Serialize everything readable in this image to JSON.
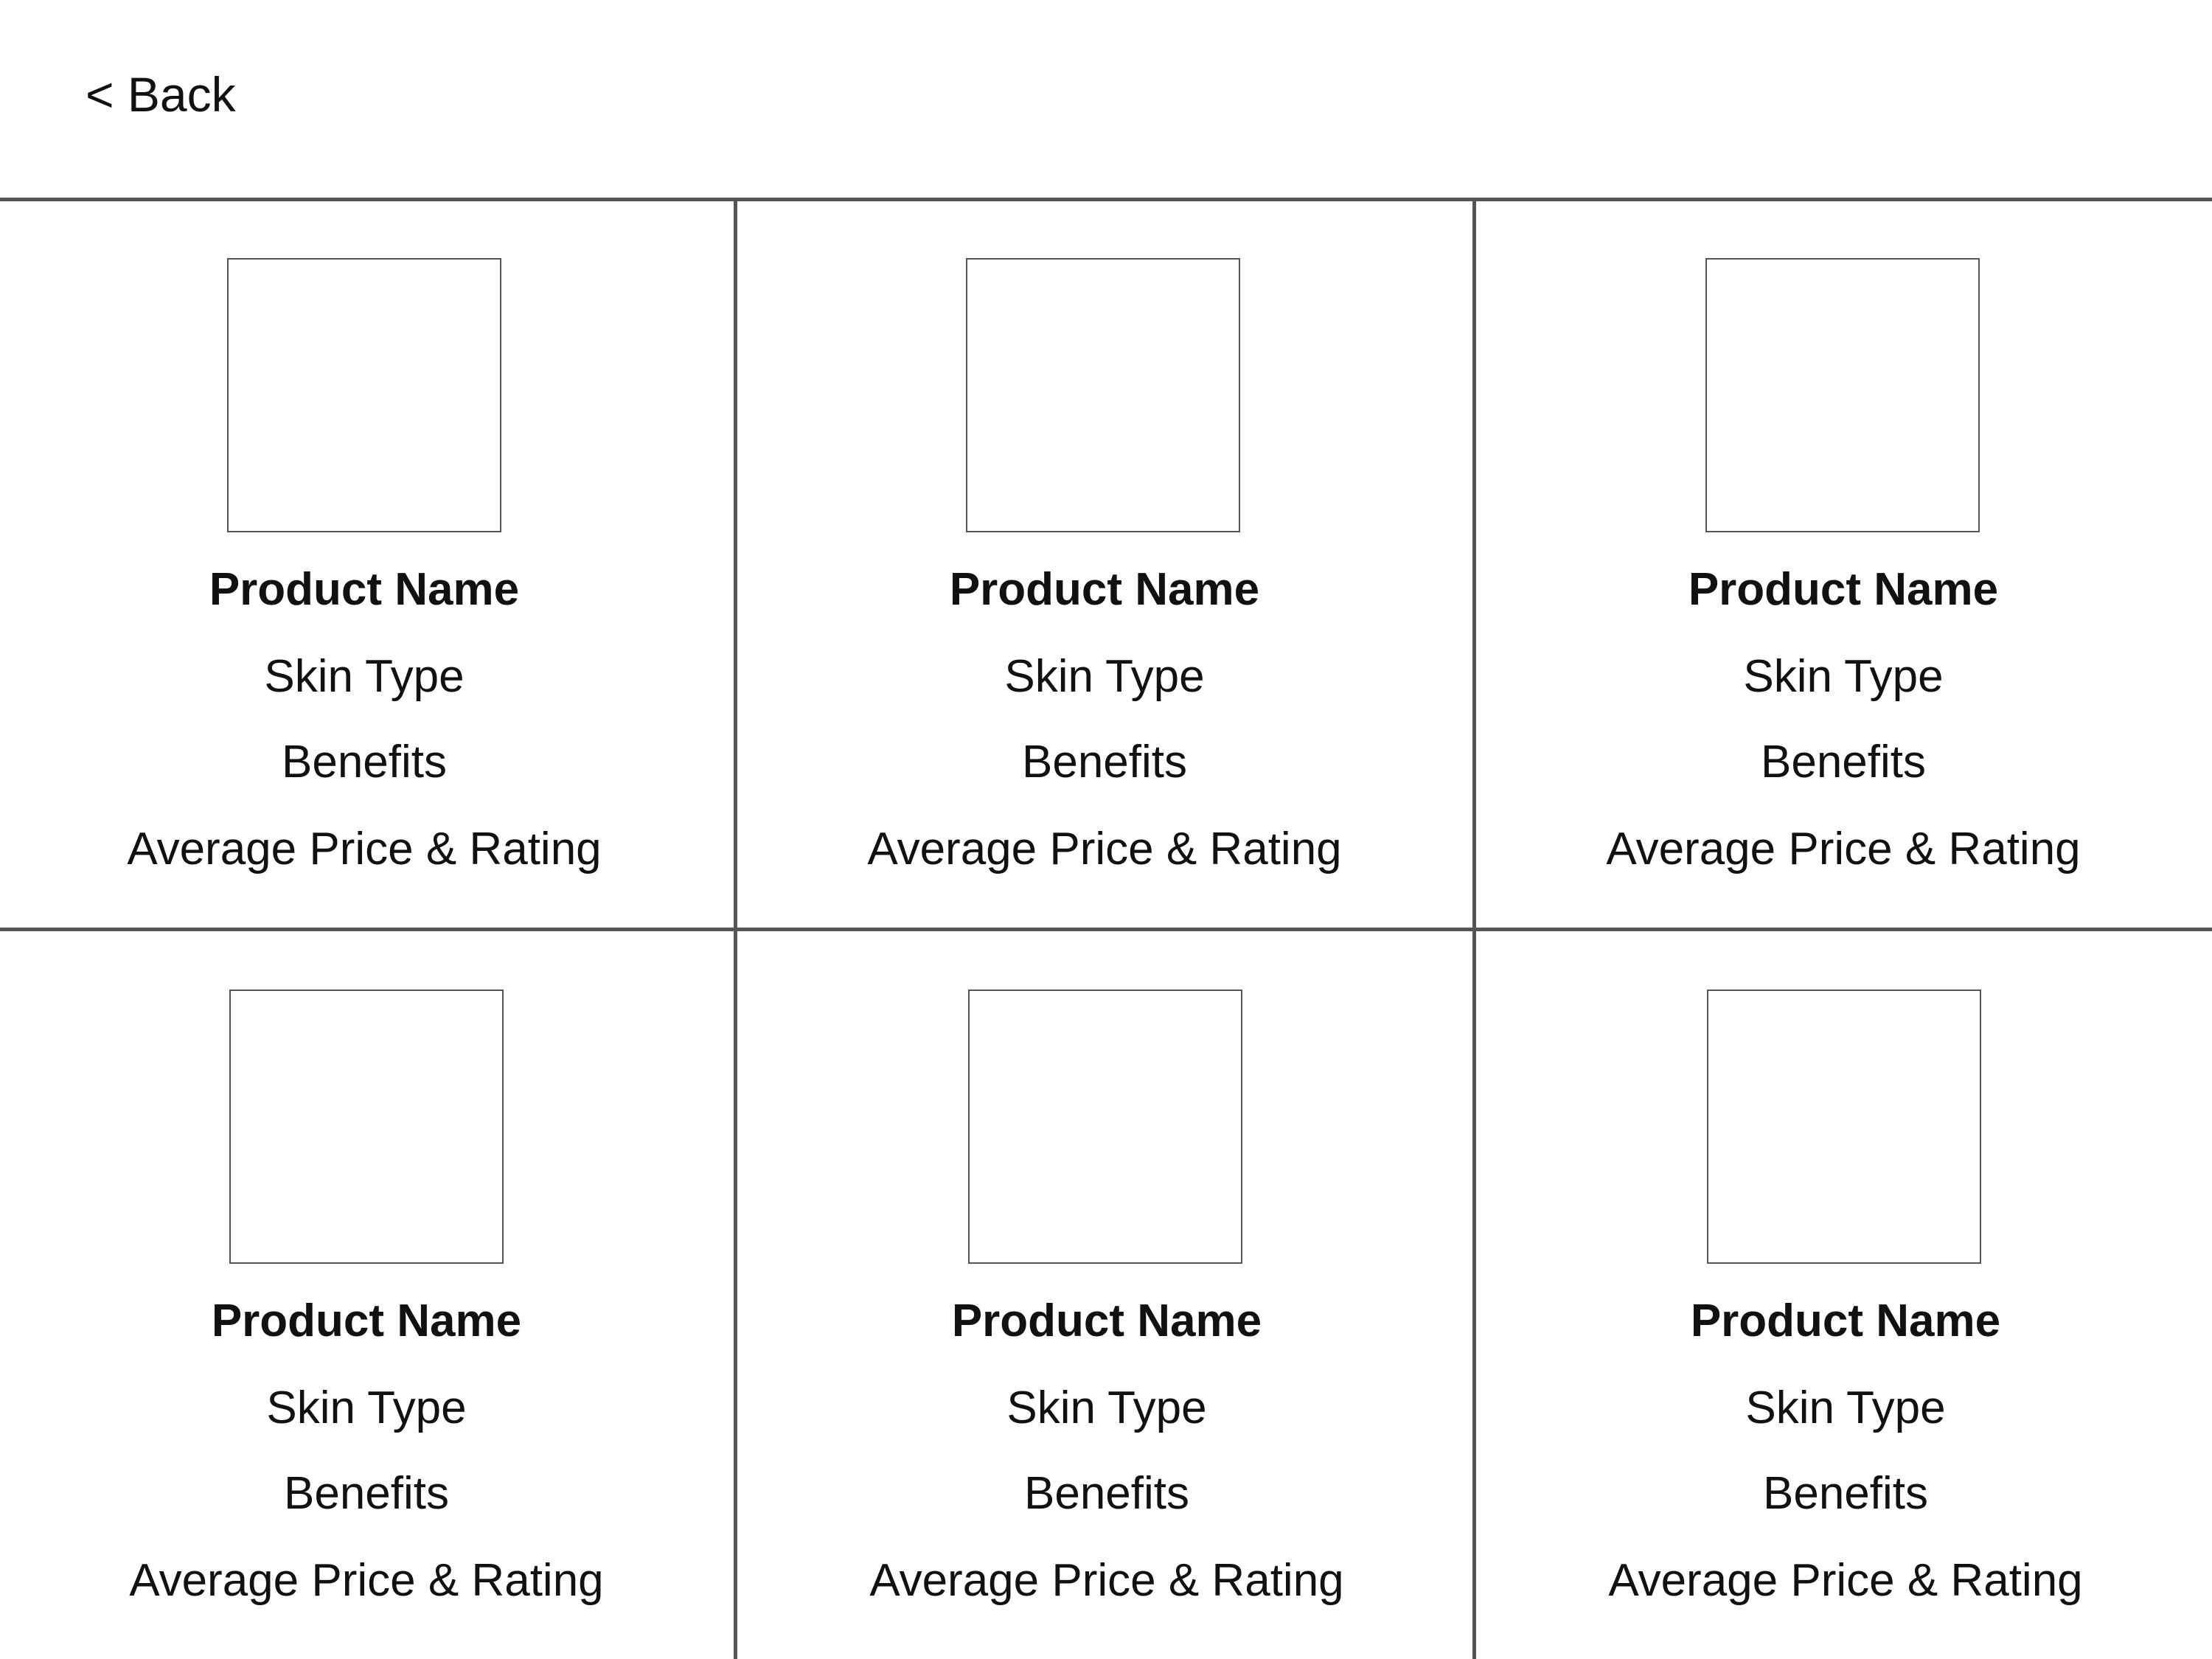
{
  "header": {
    "back_label": "< Back"
  },
  "products": [
    {
      "name": "Product Name",
      "skin_type": "Skin Type",
      "benefits": "Benefits",
      "price_rating": "Average Price & Rating"
    },
    {
      "name": "Product Name",
      "skin_type": "Skin Type",
      "benefits": "Benefits",
      "price_rating": "Average Price & Rating"
    },
    {
      "name": "Product Name",
      "skin_type": "Skin Type",
      "benefits": "Benefits",
      "price_rating": "Average Price & Rating"
    },
    {
      "name": "Product Name",
      "skin_type": "Skin Type",
      "benefits": "Benefits",
      "price_rating": "Average Price & Rating"
    },
    {
      "name": "Product Name",
      "skin_type": "Skin Type",
      "benefits": "Benefits",
      "price_rating": "Average Price & Rating"
    },
    {
      "name": "Product Name",
      "skin_type": "Skin Type",
      "benefits": "Benefits",
      "price_rating": "Average Price & Rating"
    }
  ]
}
